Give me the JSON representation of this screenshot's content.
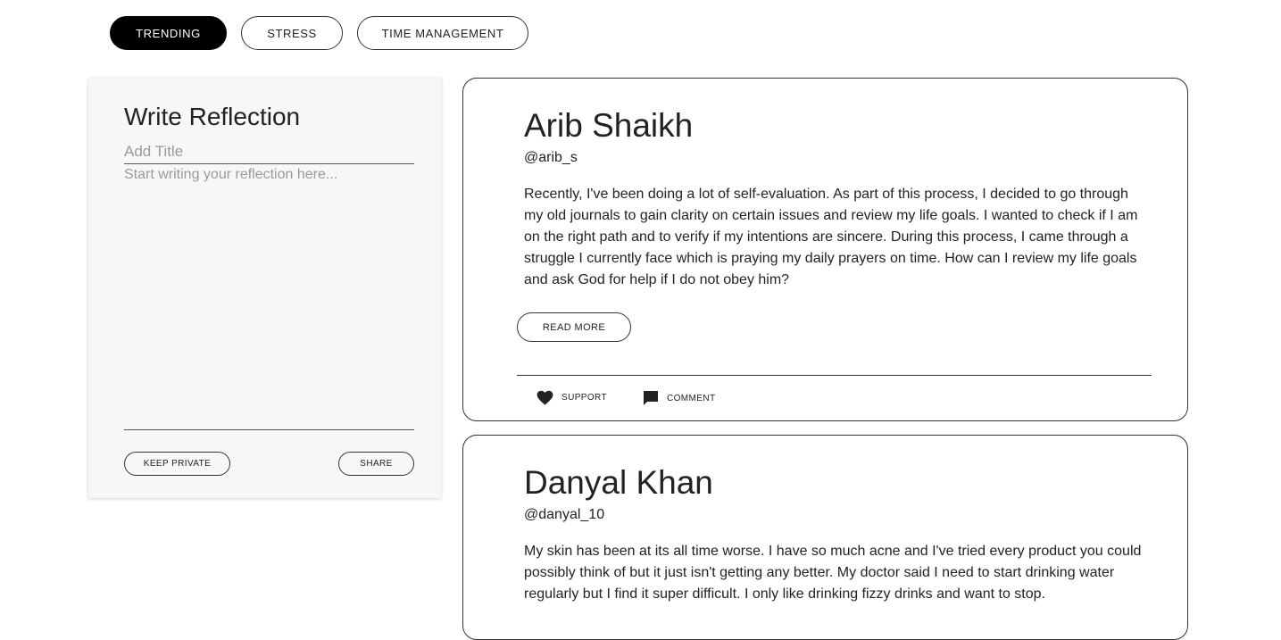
{
  "tabs": [
    {
      "label": "TRENDING",
      "active": true
    },
    {
      "label": "STRESS",
      "active": false
    },
    {
      "label": "TIME MANAGEMENT",
      "active": false
    }
  ],
  "composer": {
    "title": "Write Reflection",
    "title_placeholder": "Add Title",
    "body_placeholder": "Start writing your reflection here...",
    "keep_private_label": "KEEP PRIVATE",
    "share_label": "SHARE"
  },
  "posts": [
    {
      "author": "Arib Shaikh",
      "handle": "@arib_s",
      "body": "Recently, I've been doing a lot of self-evaluation. As part of this process, I decided to go through my old journals to gain clarity on certain issues and review my life goals. I wanted to check if I am on the right path and to verify if my intentions are sincere. During this process, I came through a struggle I currently face which is praying my daily prayers on time. How can I review my life goals and ask God for help if I do not obey him?",
      "read_more_label": "READ MORE",
      "support_label": "SUPPORT",
      "comment_label": "COMMENT"
    },
    {
      "author": "Danyal Khan",
      "handle": "@danyal_10",
      "body": "My skin has been at its all time worse. I have so much acne and I've tried every product you could possibly think of but it just isn't getting any better. My doctor said I need to start drinking water regularly but I find it super difficult. I only like drinking fizzy drinks and want to stop."
    }
  ],
  "icons": {
    "support": "heart-icon",
    "comment": "comment-icon"
  },
  "colors": {
    "accent": "#000000",
    "panel_bg": "#f7f7f7",
    "placeholder": "#9a9a9a"
  }
}
